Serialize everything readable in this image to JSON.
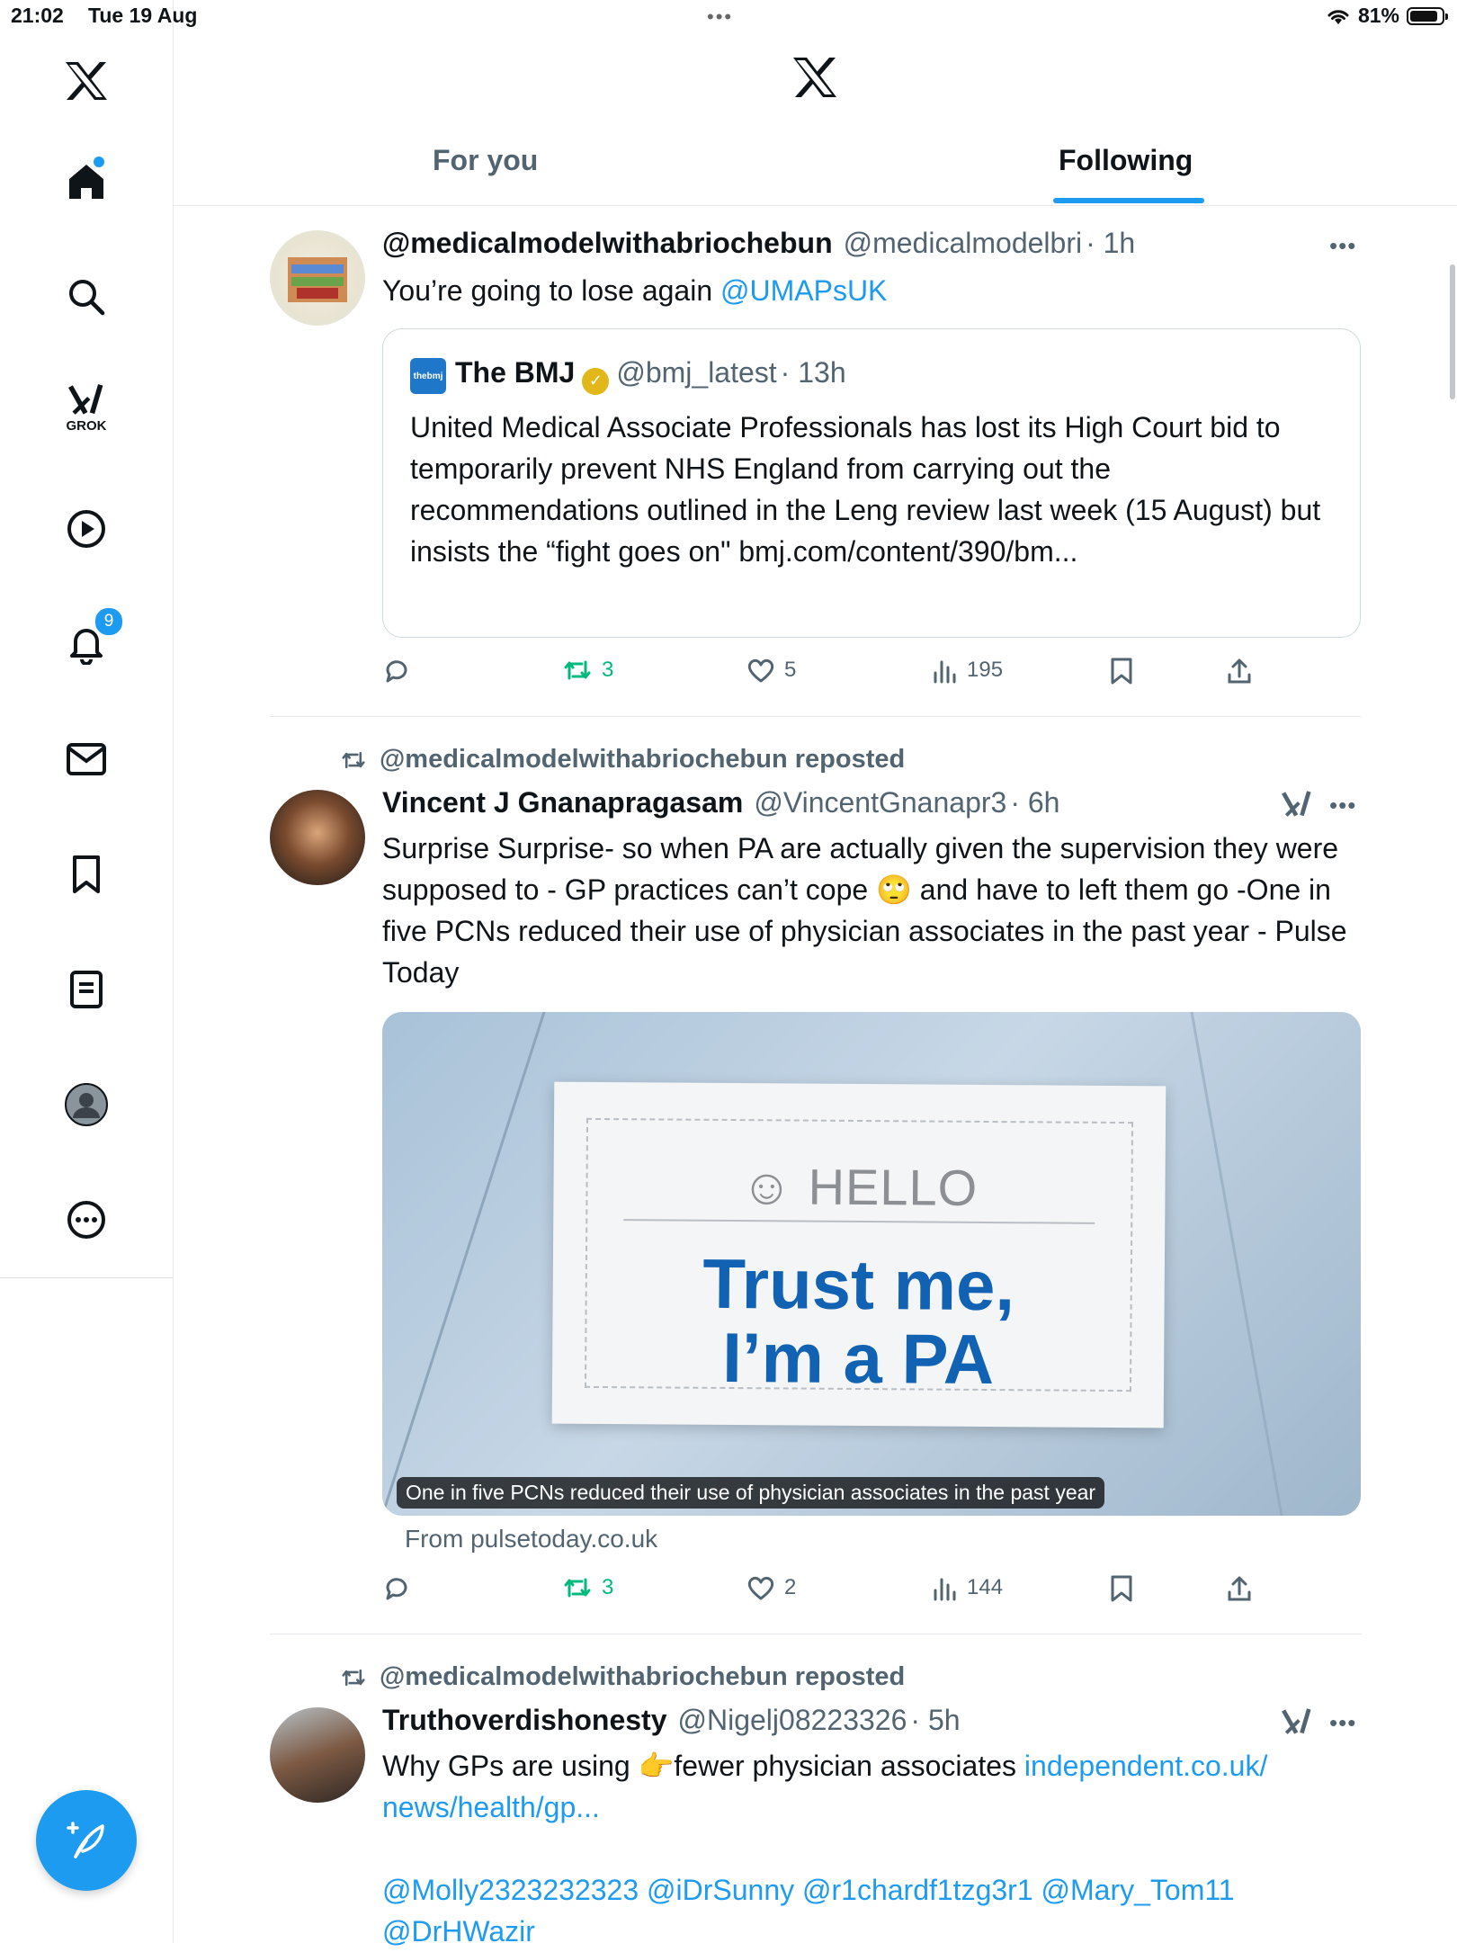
{
  "status_bar": {
    "time": "21:02",
    "date": "Tue 19 Aug",
    "dots": "•••",
    "battery": "81%"
  },
  "sidebar": {
    "items": [
      {
        "name": "x-logo"
      },
      {
        "name": "home",
        "has_dot": true
      },
      {
        "name": "search"
      },
      {
        "name": "grok",
        "label": "GROK"
      },
      {
        "name": "video"
      },
      {
        "name": "notifications",
        "badge": "9"
      },
      {
        "name": "messages"
      },
      {
        "name": "bookmarks"
      },
      {
        "name": "lists"
      },
      {
        "name": "profile"
      },
      {
        "name": "more"
      }
    ]
  },
  "tabs": {
    "for_you": "For you",
    "following": "Following",
    "active": "following"
  },
  "posts": [
    {
      "name": "@medicalmodelwithabriochebun",
      "handle": "@medicalmodelbri",
      "time": "· 1h",
      "text_prefix": "You’re going to lose again ",
      "text_link": "@UMAPsUK",
      "quote": {
        "logo_text": "thebmj",
        "name": "The BMJ",
        "handle": "@bmj_latest",
        "time": "· 13h",
        "text": "United Medical Associate Professionals has lost its High Court bid to temporarily prevent NHS England from carrying out the recommendations outlined in the Leng review last week (15 August) but insists the “fight goes on\" bmj.com/content/390/bm..."
      },
      "stats": {
        "replies": "",
        "reposts": "3",
        "likes": "5",
        "views": "195"
      }
    },
    {
      "repost_by": "@medicalmodelwithabriochebun reposted",
      "name": "Vincent J Gnanapragasam",
      "handle": "@VincentGnanapr3",
      "time": "· 6h",
      "text": "Surprise Surprise- so when PA are actually given the supervision they were supposed to - GP practices can’t cope 🙄 and have to left them go -One in five PCNs reduced their use of physician associates in the past year - Pulse Today",
      "card": {
        "hello": "HELLO",
        "line1": "Trust me,",
        "line2": "I’m a PA",
        "caption": "One in five PCNs reduced their use of physician associates in the past year",
        "source": "From pulsetoday.co.uk"
      },
      "stats": {
        "replies": "",
        "reposts": "3",
        "likes": "2",
        "views": "144"
      }
    },
    {
      "repost_by": "@medicalmodelwithabriochebun reposted",
      "name": "Truthoverdishonesty",
      "handle": "@Nigelj08223326",
      "time": "· 5h",
      "text_prefix": "Why GPs are using 👉fewer physician associates ",
      "text_link1": "independent.co.uk/",
      "text_link2": "news/health/gp...",
      "mentions": "@Molly2323232323 @iDrSunny @r1chardf1tzg3r1 @Mary_Tom11",
      "mentions2": "@DrHWazir"
    }
  ],
  "colors": {
    "accent": "#1d9bf0",
    "repost_green": "#00ba7c",
    "text": "#0f1419",
    "muted": "#536471"
  }
}
